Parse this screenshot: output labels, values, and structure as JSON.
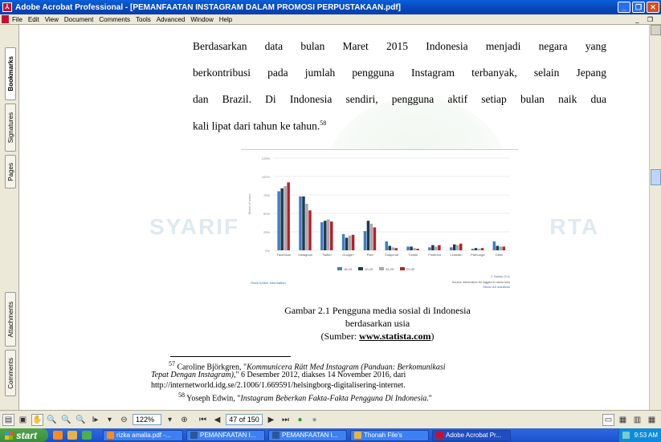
{
  "window": {
    "title": "Adobe Acrobat Professional - [PEMANFAATAN INSTAGRAM DALAM PROMOSI PERPUSTAKAAN.pdf]",
    "app_icon": "acrobat-icon"
  },
  "menu": [
    "File",
    "Edit",
    "View",
    "Document",
    "Comments",
    "Tools",
    "Advanced",
    "Window",
    "Help"
  ],
  "side_tabs": {
    "bookmarks": "Bookmarks",
    "signatures": "Signatures",
    "pages": "Pages",
    "attachments": "Attachments",
    "comments": "Comments"
  },
  "watermark": {
    "left": "SYARIF",
    "right": "RTA"
  },
  "body": {
    "line1": "Berdasarkan data bulan Maret 2015 Indonesia menjadi negara yang",
    "line2": "berkontribusi pada jumlah pengguna Instagram terbanyak, selain Jepang",
    "line3": "dan Brazil. Di Indonesia sendiri, pengguna aktif setiap bulan naik dua",
    "line4": "kali lipat dari tahun ke tahun.",
    "line4_sup": "58"
  },
  "chart_data": {
    "type": "bar",
    "categories": [
      "Facebook",
      "Instagram",
      "Twitter",
      "Google+",
      "Path",
      "Snapchat",
      "Tumblr",
      "Pinterest",
      "LinkedIn",
      "Parhunga",
      "Other"
    ],
    "series": [
      {
        "name": "16-19",
        "color": "#3f7ec6",
        "values": [
          80,
          73,
          38,
          22,
          26,
          12,
          5,
          4,
          4,
          2,
          12
        ]
      },
      {
        "name": "20-25",
        "color": "#1f3954",
        "values": [
          84,
          73,
          40,
          17,
          40,
          6,
          5,
          7,
          8,
          3,
          6
        ]
      },
      {
        "name": "26-29",
        "color": "#a9a9a9",
        "values": [
          87,
          63,
          42,
          20,
          36,
          4,
          3,
          5,
          7,
          2,
          5
        ]
      },
      {
        "name": "29-35",
        "color": "#b8202a",
        "values": [
          92,
          54,
          39,
          21,
          31,
          3,
          2,
          7,
          9,
          3,
          5
        ]
      }
    ],
    "ylim": [
      0,
      125
    ],
    "yticks": [
      "0%",
      "25%",
      "50%",
      "75%",
      "100%",
      "125%"
    ],
    "ylabel": "Share of users",
    "credit": "© Statista 2016",
    "link_left": "Show further information",
    "source_note": "Source information for logged in users only",
    "link_right": "Show our solutions"
  },
  "caption": {
    "line1": "Gambar 2.1 Pengguna media sosial di Indonesia",
    "line2": "berdasarkan usia",
    "src_prefix": "(Sumber: ",
    "src_link": "www.statista.com",
    "src_suffix": ")"
  },
  "footnotes": {
    "fn57_num": "57",
    "fn57_a": " Caroline Björkgren, \"",
    "fn57_title1": "Kommunicera Rätt Med Instagram (Panduan: Berkomunikasi",
    "fn57_title2": "Tepat Dengan Instagram),",
    "fn57_b": "\" 6 Desember 2012, diakses 14 November  2016, dari",
    "fn57_url": "http://internetworld.idg.se/2.1006/1.669591/helsingborg-digitalisering-internet.",
    "fn58_num": "58",
    "fn58_a": " Yoseph Edwin, \"",
    "fn58_title": "Instagram Beberkan Fakta-Fakta Pengguna Di Indonesia.",
    "fn58_b": "\""
  },
  "toolbar": {
    "zoom": "122%",
    "page": "47 of 150"
  },
  "taskbar": {
    "start": "start",
    "tasks": [
      "rizka amalia.pdf -...",
      "PEMANFAATAN I...",
      "PEMANFAATAN I...",
      "Thonah File's",
      "Adobe Acrobat Pr..."
    ],
    "clock": "9:53 AM"
  }
}
